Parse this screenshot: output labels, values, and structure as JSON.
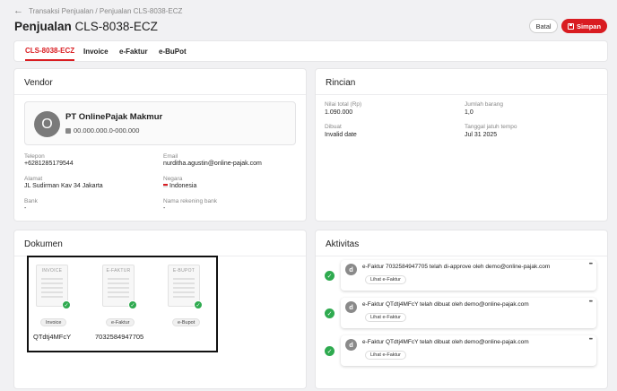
{
  "breadcrumb": {
    "back_icon": "arrow-left-icon",
    "text": "Transaksi Penjualan / Penjualan CLS-8038-ECZ"
  },
  "header": {
    "title_prefix": "Penjualan",
    "title_id": "CLS-8038-ECZ",
    "cancel_label": "Batal",
    "save_label": "Simpan",
    "save_icon": "save-icon"
  },
  "colors": {
    "accent": "#d91c21",
    "success": "#2eaa4f"
  },
  "tabs": [
    {
      "label": "CLS-8038-ECZ",
      "active": true
    },
    {
      "label": "Invoice",
      "active": false
    },
    {
      "label": "e-Faktur",
      "active": false
    },
    {
      "label": "e-BuPot",
      "active": false
    }
  ],
  "vendor": {
    "title": "Vendor",
    "avatar_letter": "O",
    "name": "PT OnlinePajak Makmur",
    "npwp": "00.000.000.0-000.000",
    "telepon_label": "Telepon",
    "telepon": "+6281285179544",
    "email_label": "Email",
    "email": "nurditha.agustin@online-pajak.com",
    "alamat_label": "Alamat",
    "alamat": "JL Sudirman Kav 34 Jakarta",
    "negara_label": "Negara",
    "negara": "Indonesia",
    "bank_label": "Bank",
    "bank": "-",
    "rekening_label": "Nama rekening bank",
    "rekening": "-"
  },
  "rincian": {
    "title": "Rincian",
    "nilai_label": "Nilai total (Rp)",
    "nilai": "1.090.000",
    "jumlah_label": "Jumlah barang",
    "jumlah": "1,0",
    "dibuat_label": "Dibuat",
    "dibuat": "Invalid date",
    "jatuh_label": "Tanggal jatuh tempo",
    "jatuh": "Jul 31 2025"
  },
  "dokumen": {
    "title": "Dokumen",
    "items": [
      {
        "thumb_label": "INVOICE",
        "chip": "Invoice",
        "number": "QTdtj4MFcY"
      },
      {
        "thumb_label": "E-FAKTUR",
        "chip": "e-Faktur",
        "number": "7032584947705"
      },
      {
        "thumb_label": "E-BUPOT",
        "chip": "e-Bupot",
        "number": ""
      }
    ]
  },
  "aktivitas": {
    "title": "Aktivitas",
    "items": [
      {
        "avatar": "d",
        "text": "e-Faktur 7032584947705 telah di-approve oleh demo@online-pajak.com",
        "chip": "Lihat e-Faktur",
        "more": "•••"
      },
      {
        "avatar": "d",
        "text": "e-Faktur QTdtj4MFcY telah dibuat oleh demo@online-pajak.com",
        "chip": "Lihat e-Faktur",
        "more": "•••"
      },
      {
        "avatar": "d",
        "text": "e-Faktur QTdtj4MFcY telah dibuat oleh demo@online-pajak.com",
        "chip": "Lihat e-Faktur",
        "more": "•••"
      }
    ]
  }
}
